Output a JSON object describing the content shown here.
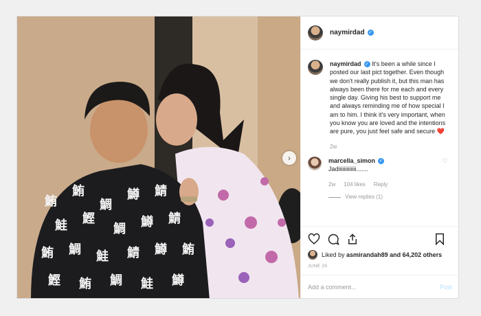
{
  "post": {
    "username": "naymirdad",
    "caption_user": "naymirdad",
    "caption": "It's been a while since I posted our last pict together. Even though we don't really publish it, but this man has always been there for me each and every single day. Giving his best to support me and always reminding me of how special I am to him. I think it's very important, when you know you are loved and the intentions are pure, you just feel safe and secure",
    "caption_emoji": "❤️",
    "caption_age": "2w",
    "comments": [
      {
        "user": "marcella_simon",
        "text": "Jadiiiiiiiiiiiii.......",
        "age": "2w",
        "likes": "104 likes",
        "reply": "Reply",
        "view_replies": "View replies (1)"
      }
    ],
    "liked_by_prefix": "Liked by",
    "liked_by_user": "asmirandah89",
    "liked_by_suffix": "and 64,202 others",
    "date": "JUNE 25",
    "add_comment_placeholder": "Add a comment...",
    "post_button": "Post"
  },
  "colors": {
    "verified": "#3897f0",
    "post_disabled": "#b2dffc",
    "heart": "#ed4956"
  },
  "icons": [
    "heart-icon",
    "comment-icon",
    "share-icon",
    "bookmark-icon",
    "chevron-right-icon",
    "verified-badge-icon"
  ]
}
